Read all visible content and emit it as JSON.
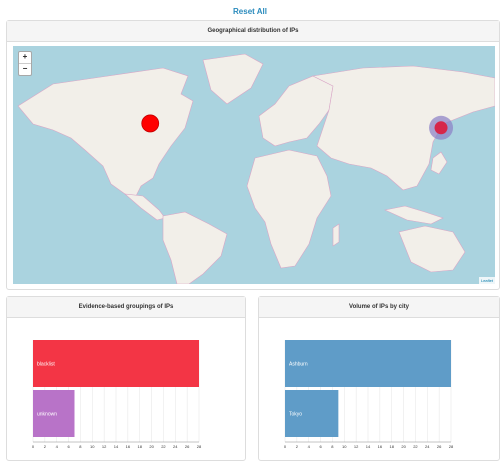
{
  "reset_label": "Reset All",
  "map": {
    "title": "Geographical distribution of IPs",
    "zoom_in": "+",
    "zoom_out": "−",
    "attribution": "Leaflet",
    "colors": {
      "water": "#aad3df",
      "land": "#f2efe9",
      "border": "#d9a6c6",
      "marker_red": "#ff0000",
      "cluster_ring": "#8a7fc4"
    },
    "markers": [
      {
        "city": "Ashburn",
        "lat": 39.0,
        "lon": -77.5
      },
      {
        "city": "Tokyo",
        "lat": 35.7,
        "lon": 139.7
      }
    ]
  },
  "evidence_chart": {
    "title": "Evidence-based groupings of IPs",
    "chart_data": {
      "type": "bar",
      "orientation": "horizontal",
      "categories": [
        "blacklist",
        "unknown"
      ],
      "values": [
        28,
        7
      ],
      "colors": [
        "#f33545",
        "#b873c8"
      ],
      "xlim": [
        0,
        28
      ],
      "ticks": [
        "0",
        "2",
        "4",
        "6",
        "8",
        "10",
        "12",
        "14",
        "16",
        "18",
        "20",
        "22",
        "24",
        "26",
        "28"
      ]
    }
  },
  "city_chart": {
    "title": "Volume of IPs by city",
    "chart_data": {
      "type": "bar",
      "orientation": "horizontal",
      "categories": [
        "Ashburn",
        "Tokyo"
      ],
      "values": [
        28,
        9
      ],
      "colors": [
        "#5f9cc8",
        "#5f9cc8"
      ],
      "xlim": [
        0,
        28
      ],
      "ticks": [
        "0",
        "2",
        "4",
        "6",
        "8",
        "10",
        "12",
        "14",
        "16",
        "18",
        "20",
        "22",
        "24",
        "26",
        "28"
      ]
    }
  }
}
